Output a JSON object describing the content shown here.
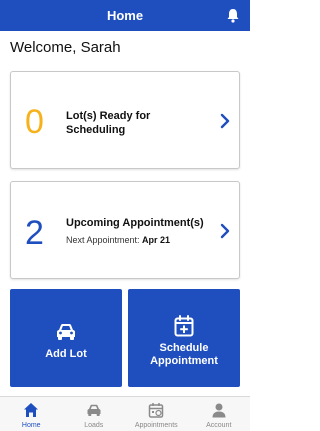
{
  "header": {
    "title": "Home"
  },
  "welcome": "Welcome, Sarah",
  "cards": {
    "lots": {
      "count": "0",
      "label": "Lot(s) Ready for Scheduling"
    },
    "appointments": {
      "count": "2",
      "label": "Upcoming Appointment(s)",
      "next_prefix": "Next Appointment: ",
      "next_date": "Apr 21"
    }
  },
  "actions": {
    "add_lot": "Add Lot",
    "schedule": "Schedule Appointment"
  },
  "tabs": [
    {
      "label": "Home",
      "icon": "home-icon",
      "active": true
    },
    {
      "label": "Loads",
      "icon": "truck-icon",
      "active": false
    },
    {
      "label": "Appointments",
      "icon": "calendar-icon",
      "active": false
    },
    {
      "label": "Account",
      "icon": "user-icon",
      "active": false
    }
  ],
  "colors": {
    "primary": "#1f4fbf",
    "accent": "#f6b21a",
    "inactive": "#888888"
  }
}
